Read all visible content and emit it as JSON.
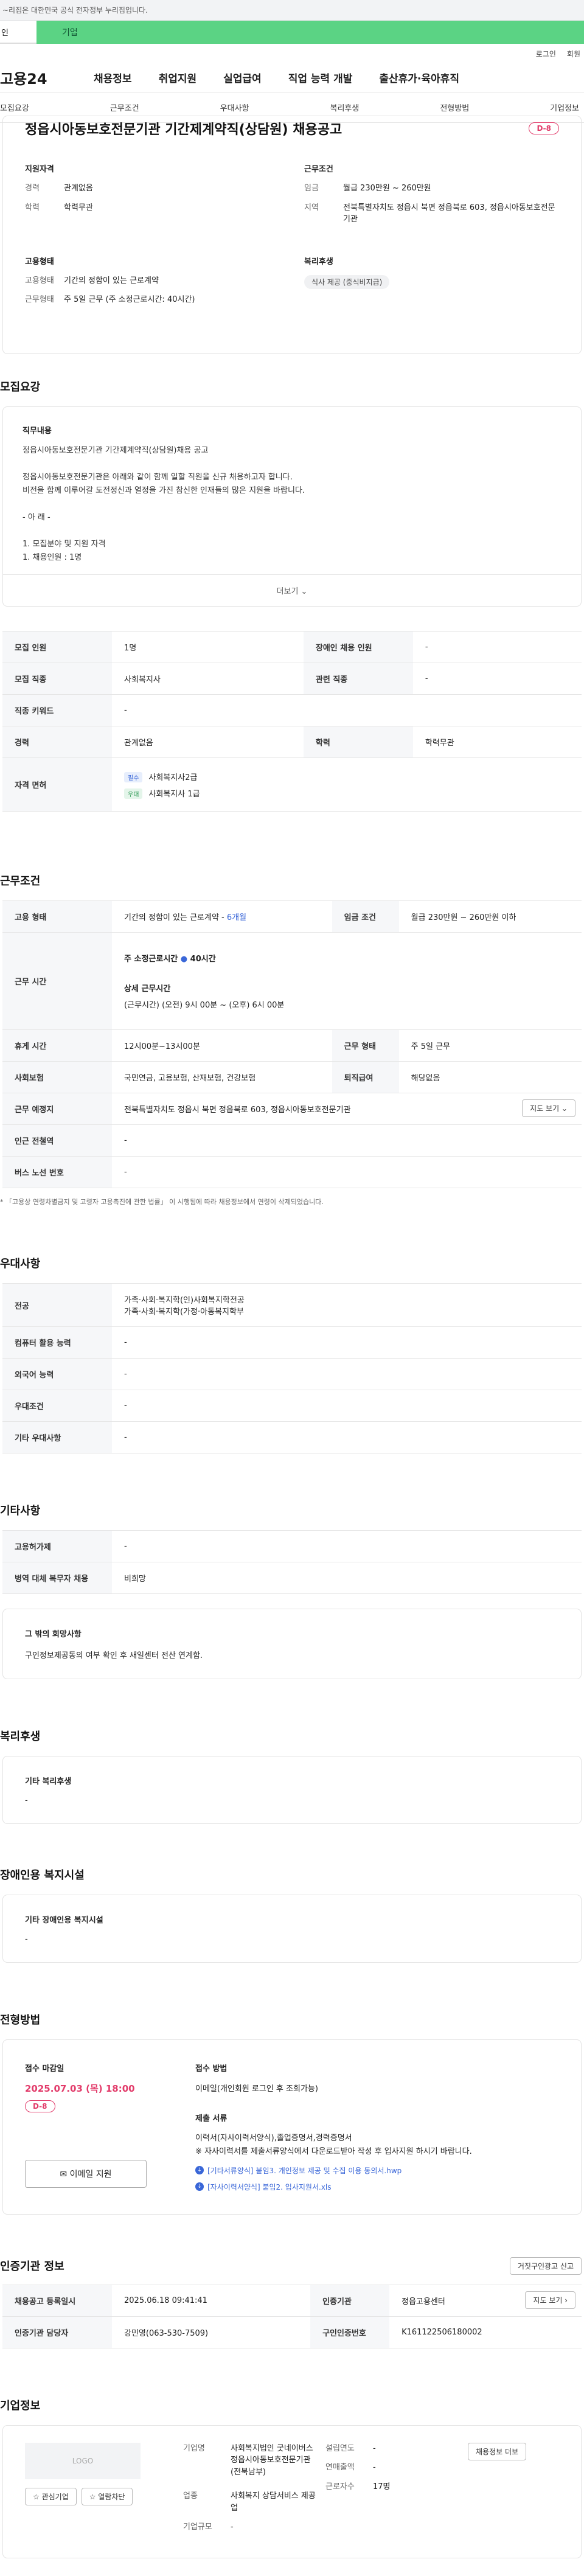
{
  "topbar": {
    "notice": "~리집은 대한민국 공식 전자정부 누리집입니다."
  },
  "tabs": {
    "person": "인",
    "company": "기업"
  },
  "util": {
    "login": "로그인",
    "join": "회원"
  },
  "gnb": {
    "logo": "고용24",
    "items": [
      "채용정보",
      "취업지원",
      "실업급여",
      "직업 능력 개발",
      "출산휴가·육아휴직"
    ]
  },
  "subnav": [
    "모집요강",
    "근무조건",
    "우대사항",
    "복리후생",
    "전형방법",
    "기업정보"
  ],
  "job": {
    "title": "정읍시아동보호전문기관 기간제계약직(상담원) 채용공고",
    "dday": "D-8",
    "summary": {
      "qual_head": "지원자격",
      "career_label": "경력",
      "career": "관계없음",
      "edu_label": "학력",
      "edu": "학력무관",
      "cond_head": "근무조건",
      "pay_label": "임금",
      "pay": "월급 230만원 ~ 260만원",
      "loc_label": "지역",
      "loc": "전북특별자치도 정읍시 북면 정읍북로 603, 정읍시아동보호전문기관",
      "emp_head": "고용형태",
      "emptype_label": "고용형태",
      "emptype": "기간의 정함이 있는 근로계약",
      "worktype_label": "근무형태",
      "worktype": "주 5일 근무 (주 소정근로시간: 40시간)",
      "welfare_head": "복리후생",
      "welfare": "식사 제공 (중식비지급)"
    }
  },
  "recruit": {
    "section": "모집요강",
    "desc_head": "직무내용",
    "desc_lines": [
      "정읍시아동보호전문기관 기간제계약직(상담원)채용 공고",
      "",
      "정읍시아동보호전문기관은 아래와 같이 함께 일할 직원을 신규 채용하고자 합니다.",
      "비전을 함께 이루어갈 도전정신과 열정을 가진 참신한 인재들의 많은 지원을 바랍니다.",
      "",
      "- 아 래 -",
      "",
      "1. 모집분야 및 지원 자격",
      "1. 채용인원 : 1명"
    ],
    "more": "더보기 ⌄",
    "rows": {
      "count_label": "모집 인원",
      "count": "1명",
      "disabled_label": "장애인 채용 인원",
      "disabled": "-",
      "job_label": "모집 직종",
      "job": "사회복지사",
      "related_label": "관련 직종",
      "related": "-",
      "keyword_label": "직종 키워드",
      "keyword": "-",
      "career_label": "경력",
      "career": "관계없음",
      "edu_label": "학력",
      "edu": "학력무관",
      "license_label": "자격 면허",
      "lic1_tag": "필수",
      "lic1": "사회복지사2급",
      "lic2_tag": "우대",
      "lic2": "사회복지사 1급"
    }
  },
  "condition": {
    "section": "근무조건",
    "emp_label": "고용 형태",
    "emp": "기간의 정함이 있는 근로계약 - ",
    "emp_period": "6개월",
    "pay_label": "임금 조건",
    "pay": "월급 230만원 ~ 260만원 이하",
    "time_label": "근무 시간",
    "weekly": "주 소정근로시간",
    "weekly_hours": "40시간",
    "detail_head": "상세 근무시간",
    "detail": "(근무시간) (오전) 9시 00분 ~ (오후) 6시 00분",
    "rest_label": "휴게 시간",
    "rest": "12시00분~13시00분",
    "form_label": "근무 형태",
    "form": "주 5일 근무",
    "insurance_label": "사회보험",
    "insurance": "국민연금, 고용보험, 산재보험, 건강보험",
    "retire_label": "퇴직급여",
    "retire": "해당없음",
    "place_label": "근무 예정지",
    "place": "전북특별자치도 정읍시 북면 정읍북로 603, 정읍시아동보호전문기관",
    "map_btn": "지도 보기 ⌄",
    "station_label": "인근 전철역",
    "station": "-",
    "bus_label": "버스 노선 번호",
    "bus": "-",
    "note": "* 「고용상 연령차별금지 및 고령자 고용촉진에 관한 법률」 이 시행됨에 따라 채용정보에서 연령이 삭제되었습니다."
  },
  "pref": {
    "section": "우대사항",
    "major_label": "전공",
    "major1": "가족·사회·복지학(인)사회복지학전공",
    "major2": "가족·사회·복지학(가정·아동복지학부",
    "computer_label": "컴퓨터 활용 능력",
    "computer": "-",
    "lang_label": "외국어 능력",
    "lang": "-",
    "cond_label": "우대조건",
    "cond": "-",
    "etc_label": "기타 우대사항",
    "etc": "-"
  },
  "etc": {
    "section": "기타사항",
    "gov_label": "고용허가제",
    "gov": "-",
    "mil_label": "병역 대체 복무자 채용",
    "mil": "비희망",
    "wish_head": "그 밖의 희망사항",
    "wish": "구인정보제공동의 여부 확인 후 새일센터 전산 연계함."
  },
  "welfare": {
    "section": "복리후생",
    "head": "기타 복리후생",
    "value": "-"
  },
  "disability": {
    "section": "장애인용 복지시설",
    "head": "기타 장애인용 복지시설",
    "value": "-"
  },
  "process": {
    "section": "전형방법",
    "deadline_head": "접수 마감일",
    "deadline": "2025.07.03 (목) 18:00",
    "dday": "D-8",
    "apply_btn": "이메일 지원",
    "method_head": "접수 방법",
    "method": "이메일(개인회원 로그인 후 조회가능)",
    "docs_head": "제출 서류",
    "docs1": "이력서(자사이력서양식),졸업증명서,경력증명서",
    "docs2": "※ 자사이력서를 제출서류양식에서 다운로드받아 작성 후 입사지원 하시기 바랍니다.",
    "file1": "[기타서류양식] 붙임3. 개인정보 제공 및 수집 이용 동의서.hwp",
    "file2": "[자사이력서양식] 붙임2. 입사지원서.xls"
  },
  "agency": {
    "section": "인증기관 정보",
    "report_btn": "거짓구인광고 신고",
    "date_label": "채용공고 등록일시",
    "date": "2025.06.18 09:41:41",
    "org_label": "인증기관",
    "org": "정읍고용센터",
    "map_btn": "지도 보기 ›",
    "manager_label": "인증기관 담당자",
    "manager": "강민영(063-530-7509)",
    "code_label": "구인인증번호",
    "code": "K161122506180002"
  },
  "company": {
    "section": "기업정보",
    "logo": "LOGO",
    "fav_btn": "☆ 관심기업",
    "block_btn": "☆ 열람차단",
    "name_label": "기업명",
    "name": "사회복지법인 굿네이버스 정읍시아동보호전문기관(전북남부)",
    "industry_label": "업종",
    "industry": "사회복지 상담서비스 제공업",
    "size_label": "기업규모",
    "size": "-",
    "founded_label": "설립연도",
    "founded": "-",
    "revenue_label": "연매출액",
    "revenue": "-",
    "employees_label": "근로자수",
    "employees": "17명",
    "more_btn": "채용정보 더보"
  }
}
